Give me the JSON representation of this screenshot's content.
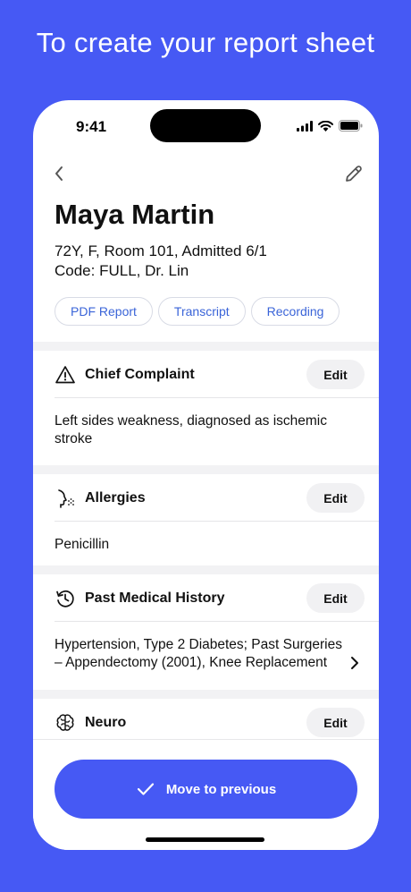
{
  "headline": "To create your report sheet",
  "status": {
    "time": "9:41"
  },
  "patient": {
    "name": "Maya Martin",
    "line1": "72Y, F, Room 101, Admitted 6/1",
    "line2": "Code: FULL, Dr. Lin"
  },
  "chips": [
    "PDF Report",
    "Transcript",
    "Recording"
  ],
  "sections": [
    {
      "title": "Chief Complaint",
      "icon": "warning-icon",
      "edit_label": "Edit",
      "body": "Left sides weakness, diagnosed as ischemic stroke"
    },
    {
      "title": "Allergies",
      "icon": "allergy-icon",
      "edit_label": "Edit",
      "body": "Penicillin"
    },
    {
      "title": "Past Medical History",
      "icon": "history-icon",
      "edit_label": "Edit",
      "body": "Hypertension, Type 2 Diabetes; Past Surgeries – Appendectomy (2001), Knee Replacement"
    },
    {
      "title": "Neuro",
      "icon": "brain-icon",
      "edit_label": "Edit"
    }
  ],
  "primary_action": {
    "label": "Move to previous",
    "icon": "checkmark-icon"
  },
  "colors": {
    "brand": "#4659f4",
    "chip_text": "#3a64d8"
  }
}
